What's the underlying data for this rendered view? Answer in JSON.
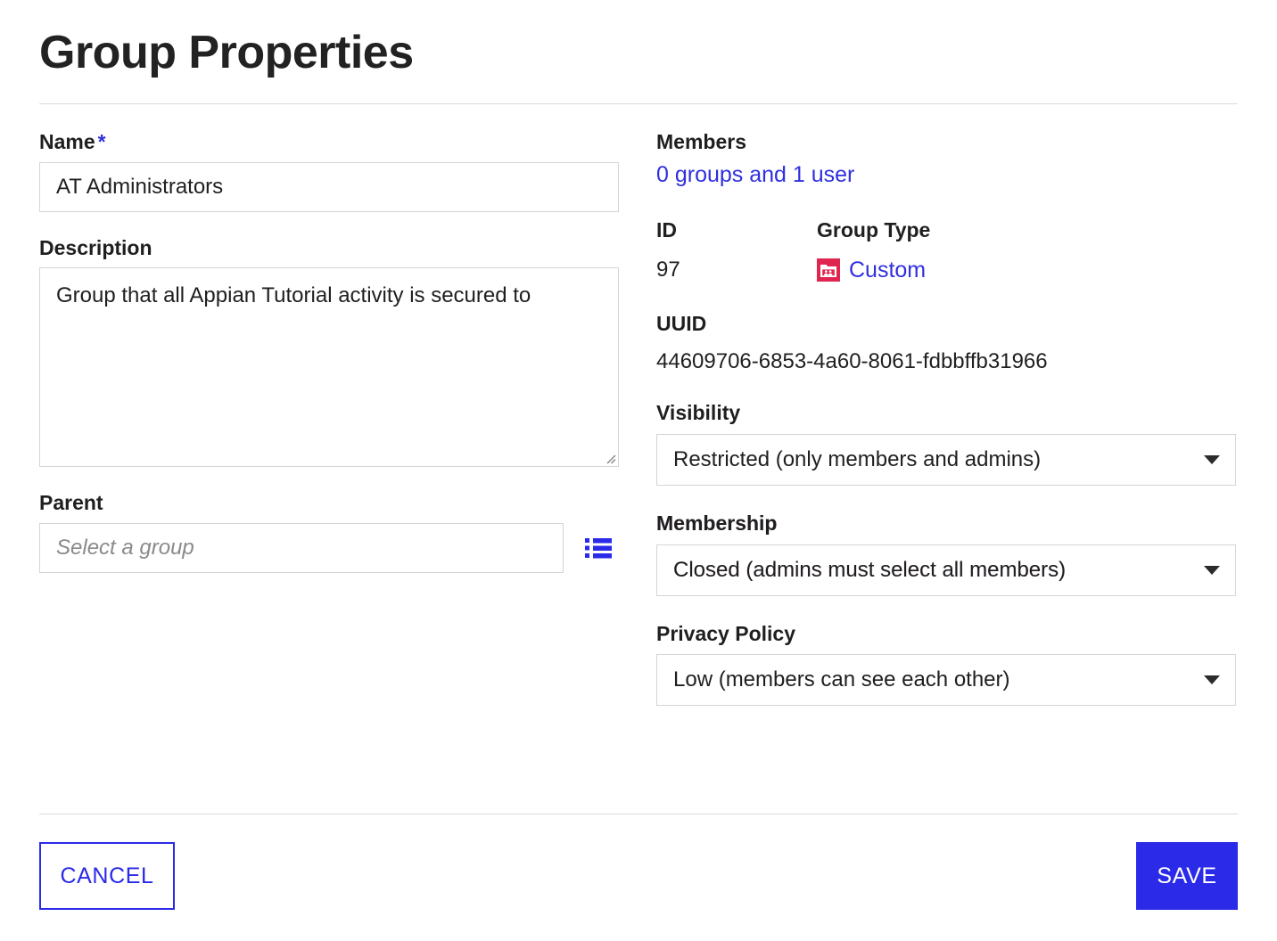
{
  "header": {
    "title": "Group Properties"
  },
  "left": {
    "name": {
      "label": "Name",
      "required_marker": "*",
      "value": "AT Administrators",
      "placeholder": ""
    },
    "description": {
      "label": "Description",
      "value": "Group that all Appian Tutorial activity is secured to",
      "placeholder": ""
    },
    "parent": {
      "label": "Parent",
      "value": "",
      "placeholder": "Select a group",
      "picker_icon": "list-icon"
    }
  },
  "right": {
    "members": {
      "label": "Members",
      "link_text": "0 groups and 1 user"
    },
    "id": {
      "label": "ID",
      "value": "97"
    },
    "group_type": {
      "label": "Group Type",
      "value": "Custom",
      "icon": "custom-group-folder-icon"
    },
    "uuid": {
      "label": "UUID",
      "value": "44609706-6853-4a60-8061-fdbbffb31966"
    },
    "visibility": {
      "label": "Visibility",
      "value": "Restricted (only members and admins)",
      "caret_icon": "chevron-down-icon"
    },
    "membership": {
      "label": "Membership",
      "value": "Closed (admins must select all members)",
      "caret_icon": "chevron-down-icon"
    },
    "privacy_policy": {
      "label": "Privacy Policy",
      "value": "Low (members can see each other)",
      "caret_icon": "chevron-down-icon"
    }
  },
  "footer": {
    "cancel_label": "CANCEL",
    "save_label": "SAVE"
  },
  "colors": {
    "accent_blue": "#2a2ae8",
    "link_blue": "#2f2fe0",
    "group_type_icon": "#e0264e",
    "border_gray": "#d5d5d5",
    "divider_gray": "#dcdcdc",
    "text_dark": "#1f1f1f",
    "placeholder_gray": "#8a8a8a"
  }
}
